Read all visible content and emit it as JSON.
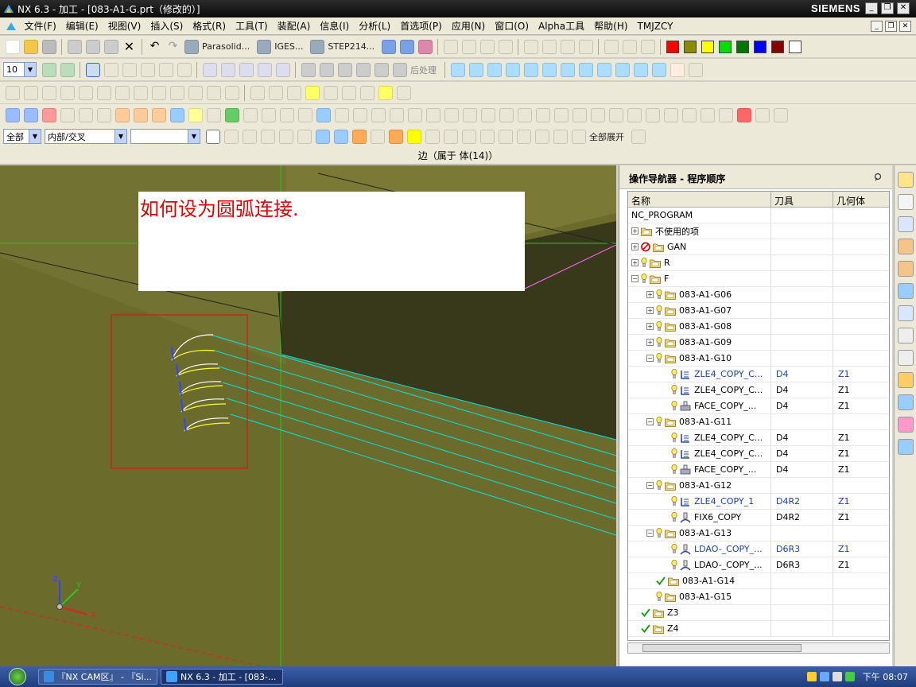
{
  "window": {
    "title": "NX 6.3 - 加工 - [083-A1-G.prt（修改的）]",
    "brand": "SIEMENS",
    "minimize": "_",
    "restore": "❐",
    "close": "✕"
  },
  "menu": {
    "items": [
      "文件(F)",
      "编辑(E)",
      "视图(V)",
      "插入(S)",
      "格式(R)",
      "工具(T)",
      "装配(A)",
      "信息(I)",
      "分析(L)",
      "首选项(P)",
      "应用(N)",
      "窗口(O)",
      "Alpha工具",
      "帮助(H)",
      "TMJZCY"
    ]
  },
  "toolbar": {
    "parasolid": "Parasolid...",
    "iges": "IGES...",
    "step": "STEP214...",
    "layer_value": "10",
    "postprocess": "后处理",
    "filter_value": "全部",
    "mode_value": "内部/交叉",
    "expand_all": "全部展开",
    "colors": [
      "#ff0000",
      "#8b8b00",
      "#ffff00",
      "#00dd00",
      "#007700",
      "#0000ff",
      "#880000",
      "#ffffff"
    ]
  },
  "status": {
    "message": "边（属于 体(14)）"
  },
  "viewport": {
    "note": "如何设为圆弧连接.",
    "triad": {
      "x": "X",
      "y": "Y",
      "z": "Z"
    }
  },
  "navigator": {
    "title": "操作导航器 - 程序顺序",
    "columns": {
      "name": "名称",
      "tool": "刀具",
      "geometry": "几何体"
    },
    "rows": [
      {
        "name": "NC_PROGRAM",
        "tool": "",
        "geom": "",
        "level": 0,
        "exp": "",
        "icon": "",
        "blue": false
      },
      {
        "name": "不使用的项",
        "tool": "",
        "geom": "",
        "level": 0,
        "exp": "+",
        "icon": "folder",
        "blue": false
      },
      {
        "name": "GAN",
        "tool": "",
        "geom": "",
        "level": 0,
        "exp": "+",
        "icon": "nogo-folder",
        "blue": false
      },
      {
        "name": "R",
        "tool": "",
        "geom": "",
        "level": 0,
        "exp": "+",
        "icon": "bulb-folder",
        "blue": false
      },
      {
        "name": "F",
        "tool": "",
        "geom": "",
        "level": 0,
        "exp": "-",
        "icon": "bulb-folder",
        "blue": false
      },
      {
        "name": "083-A1-G06",
        "tool": "",
        "geom": "",
        "level": 1,
        "exp": "+",
        "icon": "bulb-folder",
        "blue": false
      },
      {
        "name": "083-A1-G07",
        "tool": "",
        "geom": "",
        "level": 1,
        "exp": "+",
        "icon": "bulb-folder",
        "blue": false
      },
      {
        "name": "083-A1-G08",
        "tool": "",
        "geom": "",
        "level": 1,
        "exp": "+",
        "icon": "bulb-folder",
        "blue": false
      },
      {
        "name": "083-A1-G09",
        "tool": "",
        "geom": "",
        "level": 1,
        "exp": "+",
        "icon": "bulb-folder",
        "blue": false
      },
      {
        "name": "083-A1-G10",
        "tool": "",
        "geom": "",
        "level": 1,
        "exp": "-",
        "icon": "bulb-folder",
        "blue": false
      },
      {
        "name": "ZLE4_COPY_C...",
        "tool": "D4",
        "geom": "Z1",
        "level": 2,
        "exp": "",
        "icon": "bulb-op",
        "blue": true
      },
      {
        "name": "ZLE4_COPY_C...",
        "tool": "D4",
        "geom": "Z1",
        "level": 2,
        "exp": "",
        "icon": "bulb-op",
        "blue": false
      },
      {
        "name": "FACE_COPY_...",
        "tool": "D4",
        "geom": "Z1",
        "level": 2,
        "exp": "",
        "icon": "bulb-face",
        "blue": false
      },
      {
        "name": "083-A1-G11",
        "tool": "",
        "geom": "",
        "level": 1,
        "exp": "-",
        "icon": "bulb-folder",
        "blue": false
      },
      {
        "name": "ZLE4_COPY_C...",
        "tool": "D4",
        "geom": "Z1",
        "level": 2,
        "exp": "",
        "icon": "bulb-op",
        "blue": false
      },
      {
        "name": "ZLE4_COPY_C...",
        "tool": "D4",
        "geom": "Z1",
        "level": 2,
        "exp": "",
        "icon": "bulb-op",
        "blue": false
      },
      {
        "name": "FACE_COPY_...",
        "tool": "D4",
        "geom": "Z1",
        "level": 2,
        "exp": "",
        "icon": "bulb-face",
        "blue": false
      },
      {
        "name": "083-A1-G12",
        "tool": "",
        "geom": "",
        "level": 1,
        "exp": "-",
        "icon": "bulb-folder",
        "blue": false
      },
      {
        "name": "ZLE4_COPY_1",
        "tool": "D4R2",
        "geom": "Z1",
        "level": 2,
        "exp": "",
        "icon": "bulb-op",
        "blue": true
      },
      {
        "name": "FIX6_COPY",
        "tool": "D4R2",
        "geom": "Z1",
        "level": 2,
        "exp": "",
        "icon": "bulb-fix",
        "blue": false
      },
      {
        "name": "083-A1-G13",
        "tool": "",
        "geom": "",
        "level": 1,
        "exp": "-",
        "icon": "bulb-folder",
        "blue": false
      },
      {
        "name": "LDAO-_COPY_...",
        "tool": "D6R3",
        "geom": "Z1",
        "level": 2,
        "exp": "",
        "icon": "bulb-fix",
        "blue": true
      },
      {
        "name": "LDAO-_COPY_...",
        "tool": "D6R3",
        "geom": "Z1",
        "level": 2,
        "exp": "",
        "icon": "bulb-fix",
        "blue": false
      },
      {
        "name": "083-A1-G14",
        "tool": "",
        "geom": "",
        "level": 1,
        "exp": "",
        "icon": "check-folder",
        "blue": false
      },
      {
        "name": "083-A1-G15",
        "tool": "",
        "geom": "",
        "level": 1,
        "exp": "",
        "icon": "bulb-folder",
        "blue": false
      },
      {
        "name": "Z3",
        "tool": "",
        "geom": "",
        "level": 0,
        "exp": "",
        "icon": "check-folder",
        "blue": false
      },
      {
        "name": "Z4",
        "tool": "",
        "geom": "",
        "level": 0,
        "exp": "",
        "icon": "check-folder",
        "blue": false
      }
    ]
  },
  "taskbar": {
    "buttons": [
      "『NX CAM区』 - 『Si...",
      "NX 6.3 - 加工 - [083-..."
    ],
    "clock": "下午 08:07"
  }
}
